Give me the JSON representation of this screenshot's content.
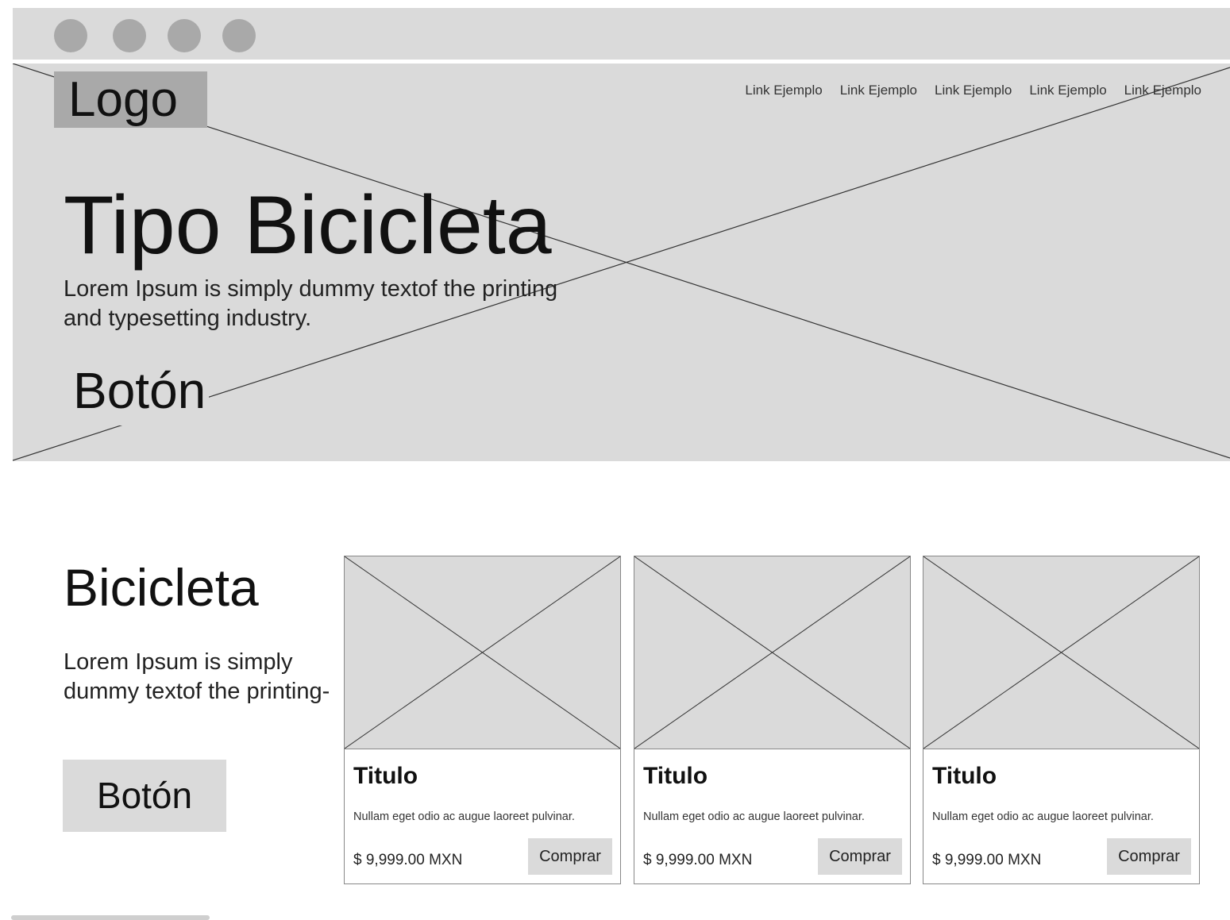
{
  "colors": {
    "placeholder_fill": "#dadada",
    "dark_placeholder": "#a9a9a9",
    "line": "#333333",
    "text": "#111111",
    "page_background": "#ffffff"
  },
  "window": {
    "controls": [
      "window-dot",
      "window-dot",
      "window-dot",
      "window-dot"
    ]
  },
  "header": {
    "logo": "Logo",
    "nav_links": [
      "Link Ejemplo",
      "Link Ejemplo",
      "Link Ejemplo",
      "Link Ejemplo",
      "Link Ejemplo"
    ]
  },
  "hero": {
    "title": "Tipo Bicicleta",
    "text": "Lorem Ipsum is simply dummy textof the printing and typesetting industry.",
    "button": "Botón"
  },
  "section": {
    "title": "Bicicleta",
    "text": "Lorem Ipsum is simply dummy textof the printing-",
    "button": "Botón"
  },
  "cards": [
    {
      "title": "Titulo",
      "description": "Nullam eget odio ac augue laoreet pulvinar.",
      "price": "$ 9,999.00 MXN",
      "button": "Comprar"
    },
    {
      "title": "Titulo",
      "description": "Nullam eget odio ac augue laoreet pulvinar.",
      "price": "$ 9,999.00 MXN",
      "button": "Comprar"
    },
    {
      "title": "Titulo",
      "description": "Nullam eget odio ac augue laoreet pulvinar.",
      "price": "$ 9,999.00 MXN",
      "button": "Comprar"
    }
  ]
}
